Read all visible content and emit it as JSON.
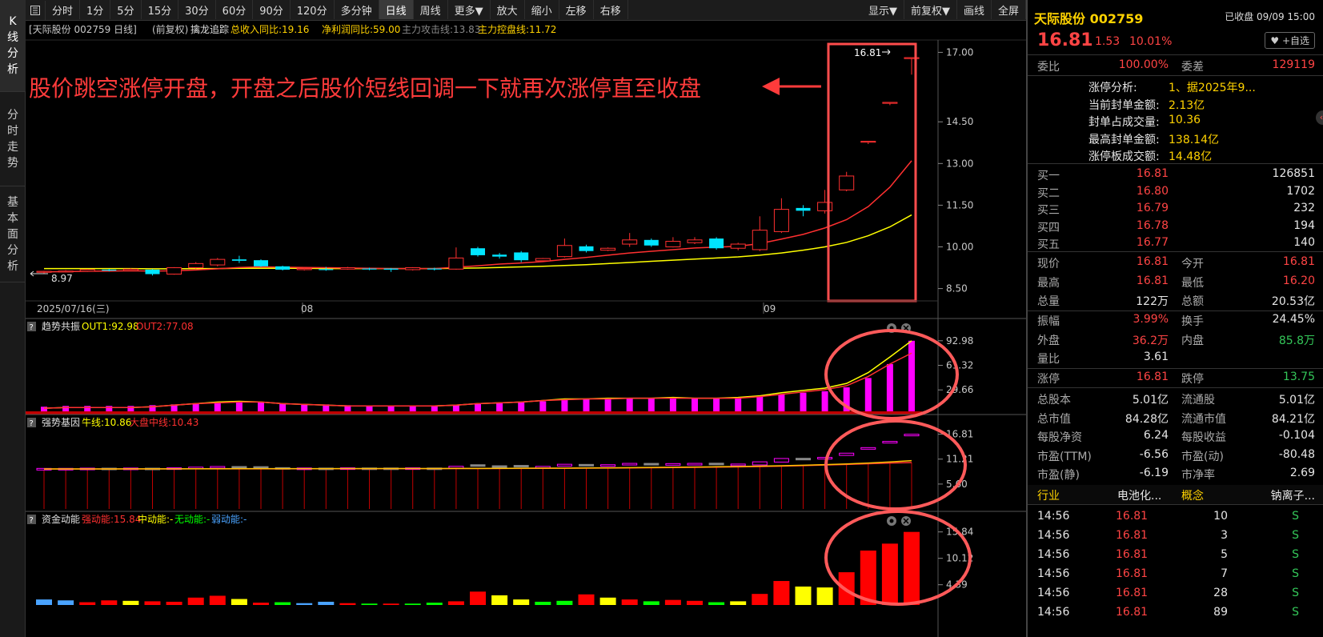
{
  "sidebar": {
    "tabs": [
      {
        "label": "K线分析",
        "active": true
      },
      {
        "label": "分时走势",
        "active": false
      },
      {
        "label": "基本面分析",
        "active": false
      }
    ]
  },
  "toolbar": {
    "left_items": [
      "分时",
      "1分",
      "5分",
      "15分",
      "30分",
      "60分",
      "90分",
      "120分",
      "多分钟",
      "日线",
      "周线",
      "更多▼",
      "放大",
      "缩小",
      "左移",
      "右移"
    ],
    "active": "日线",
    "right_items": [
      "显示▼",
      "前复权▼",
      "画线",
      "全屏"
    ]
  },
  "main_chart": {
    "header_prefix": "[天际股份 002759 日线]",
    "adjust": "(前复权)",
    "indicator_name": "擒龙追踪",
    "revenue_yoy": "总收入同比:19.16",
    "profit_yoy": "净利润同比:59.00",
    "main_attack": "主力攻击线:13.83",
    "main_control": "主力控盘线:11.72",
    "y_ticks": [
      "17.00",
      "14.50",
      "13.00",
      "11.50",
      "10.00",
      "8.50"
    ],
    "x_labels": [
      "2025/07/16(三)",
      "08",
      "09"
    ],
    "low_label": "8.97",
    "high_label": "16.81",
    "annotation": "股价跳空涨停开盘，开盘之后股价短线回调一下就再次涨停直至收盘"
  },
  "panel1": {
    "title": "趋势共振",
    "out1": "OUT1:92.98",
    "out2": "OUT2:77.08",
    "y_ticks": [
      "92.98",
      "61.32",
      "29.66"
    ]
  },
  "panel2": {
    "title": "强势基因",
    "bull": "牛线:10.86",
    "market": "大盘中线:10.43",
    "y_ticks": [
      "16.81",
      "11.21",
      "5.60"
    ]
  },
  "panel3": {
    "title": "资金动能",
    "strong": "强动能:15.84",
    "mid": "中动能:-",
    "none": "无动能:-",
    "weak": "弱动能:-",
    "y_ticks": [
      "15.84",
      "10.12",
      "4.39"
    ]
  },
  "quote": {
    "name": "天际股份 002759",
    "status": "已收盘 09/09 15:00",
    "price": "16.81",
    "change": "1.53",
    "change_pct": "10.01%",
    "watch_btn": "+自选",
    "weibi_label": "委比",
    "weibi": "100.00%",
    "weicha_label": "委差",
    "weicha": "129119",
    "limit_analysis": [
      {
        "label": "涨停分析:",
        "value": "1、据2025年9..."
      },
      {
        "label": "当前封单金额:",
        "value": "2.13亿"
      },
      {
        "label": "封单占成交量:",
        "value": "10.36"
      },
      {
        "label": "最高封单金额:",
        "value": "138.14亿"
      },
      {
        "label": "涨停板成交额:",
        "value": "14.48亿"
      }
    ],
    "bids": [
      {
        "label": "买一",
        "price": "16.81",
        "vol": "126851"
      },
      {
        "label": "买二",
        "price": "16.80",
        "vol": "1702"
      },
      {
        "label": "买三",
        "price": "16.79",
        "vol": "232"
      },
      {
        "label": "买四",
        "price": "16.78",
        "vol": "194"
      },
      {
        "label": "买五",
        "price": "16.77",
        "vol": "140"
      }
    ],
    "stats_a": [
      [
        "现价",
        "16.81",
        "red",
        "今开",
        "16.81",
        "red"
      ],
      [
        "最高",
        "16.81",
        "red",
        "最低",
        "16.20",
        "red"
      ],
      [
        "总量",
        "122万",
        "white",
        "总额",
        "20.53亿",
        "white"
      ]
    ],
    "stats_b": [
      [
        "振幅",
        "3.99%",
        "red",
        "换手",
        "24.45%",
        "white"
      ],
      [
        "外盘",
        "36.2万",
        "red",
        "内盘",
        "85.8万",
        "green"
      ],
      [
        "量比",
        "3.61",
        "white",
        "",
        "",
        ""
      ]
    ],
    "stats_c": [
      [
        "涨停",
        "16.81",
        "red",
        "跌停",
        "13.75",
        "green"
      ]
    ],
    "stats_d": [
      [
        "总股本",
        "5.01亿",
        "白",
        "流通股",
        "5.01亿",
        "white"
      ],
      [
        "总市值",
        "84.28亿",
        "white",
        "流通市值",
        "84.21亿",
        "white"
      ],
      [
        "每股净资",
        "6.24",
        "white",
        "每股收益",
        "-0.104",
        "white"
      ],
      [
        "市盈(TTM)",
        "-6.56",
        "white",
        "市盈(动)",
        "-80.48",
        "white"
      ],
      [
        "市盈(静)",
        "-6.19",
        "white",
        "市净率",
        "2.69",
        "white"
      ]
    ],
    "industry_label": "行业",
    "industry": "电池化...",
    "concept_label": "概念",
    "concept": "钠离子...",
    "ticks": [
      {
        "time": "14:56",
        "price": "16.81",
        "vol": "10",
        "side": "S"
      },
      {
        "time": "14:56",
        "price": "16.81",
        "vol": "3",
        "side": "S"
      },
      {
        "time": "14:56",
        "price": "16.81",
        "vol": "5",
        "side": "S"
      },
      {
        "time": "14:56",
        "price": "16.81",
        "vol": "7",
        "side": "S"
      },
      {
        "time": "14:56",
        "price": "16.81",
        "vol": "28",
        "side": "S"
      },
      {
        "time": "14:56",
        "price": "16.81",
        "vol": "89",
        "side": "S"
      }
    ]
  },
  "colors": {
    "up": "#ff3030",
    "down": "#00e5ff",
    "ma1": "#ff3030",
    "ma2": "#ffff00",
    "magenta": "#ff00ff",
    "annot": "#ff3b3b",
    "circle": "#ff5a5a"
  },
  "chart_data": {
    "type": "candlestick",
    "ylim": [
      8.2,
      17.3
    ],
    "candles": [
      [
        9.1,
        9.12,
        9.05,
        9.14
      ],
      [
        9.12,
        9.13,
        9.08,
        9.16
      ],
      [
        9.12,
        9.18,
        9.1,
        9.2
      ],
      [
        9.18,
        9.15,
        9.12,
        9.21
      ],
      [
        9.15,
        9.2,
        9.13,
        9.23
      ],
      [
        9.18,
        9.02,
        8.97,
        9.2
      ],
      [
        9.02,
        9.25,
        9.0,
        9.27
      ],
      [
        9.25,
        9.4,
        9.22,
        9.45
      ],
      [
        9.35,
        9.55,
        9.3,
        9.6
      ],
      [
        9.55,
        9.5,
        9.42,
        9.68
      ],
      [
        9.52,
        9.3,
        9.28,
        9.55
      ],
      [
        9.3,
        9.18,
        9.15,
        9.32
      ],
      [
        9.18,
        9.22,
        9.15,
        9.26
      ],
      [
        9.2,
        9.18,
        9.14,
        9.28
      ],
      [
        9.2,
        9.25,
        9.18,
        9.28
      ],
      [
        9.22,
        9.2,
        9.16,
        9.25
      ],
      [
        9.22,
        9.18,
        9.1,
        9.24
      ],
      [
        9.18,
        9.25,
        9.15,
        9.27
      ],
      [
        9.22,
        9.2,
        9.15,
        9.25
      ],
      [
        9.2,
        9.6,
        9.18,
        9.98
      ],
      [
        9.95,
        9.7,
        9.65,
        10.0
      ],
      [
        9.72,
        9.65,
        9.58,
        9.78
      ],
      [
        9.8,
        9.52,
        9.45,
        9.85
      ],
      [
        9.5,
        9.58,
        9.48,
        9.6
      ],
      [
        9.65,
        10.05,
        9.62,
        10.3
      ],
      [
        10.02,
        9.85,
        9.8,
        10.08
      ],
      [
        9.88,
        9.95,
        9.85,
        9.98
      ],
      [
        10.1,
        10.25,
        10.0,
        10.5
      ],
      [
        10.25,
        10.05,
        10.0,
        10.3
      ],
      [
        10.0,
        10.2,
        9.98,
        10.35
      ],
      [
        10.15,
        10.25,
        10.1,
        10.35
      ],
      [
        10.3,
        9.95,
        9.9,
        10.35
      ],
      [
        9.95,
        10.1,
        9.88,
        10.15
      ],
      [
        9.9,
        10.6,
        9.85,
        11.1
      ],
      [
        10.55,
        11.35,
        10.5,
        11.75
      ],
      [
        11.4,
        11.3,
        11.1,
        11.5
      ],
      [
        11.3,
        11.6,
        11.2,
        12.05
      ],
      [
        12.05,
        12.55,
        12.0,
        12.7
      ],
      [
        13.8,
        13.8,
        13.7,
        13.8
      ],
      [
        15.2,
        15.2,
        15.1,
        15.2
      ],
      [
        16.81,
        16.81,
        16.2,
        16.81
      ]
    ],
    "ma_fast": [
      9.1,
      9.11,
      9.12,
      9.13,
      9.14,
      9.13,
      9.14,
      9.17,
      9.21,
      9.26,
      9.28,
      9.27,
      9.26,
      9.25,
      9.24,
      9.23,
      9.22,
      9.22,
      9.22,
      9.27,
      9.32,
      9.38,
      9.42,
      9.47,
      9.55,
      9.62,
      9.7,
      9.78,
      9.84,
      9.9,
      9.96,
      9.99,
      10.02,
      10.12,
      10.28,
      10.45,
      10.68,
      10.98,
      11.45,
      12.15,
      13.1
    ],
    "ma_slow": [
      9.22,
      9.22,
      9.22,
      9.22,
      9.22,
      9.21,
      9.21,
      9.22,
      9.22,
      9.23,
      9.23,
      9.23,
      9.23,
      9.22,
      9.22,
      9.22,
      9.22,
      9.22,
      9.22,
      9.23,
      9.24,
      9.26,
      9.28,
      9.3,
      9.33,
      9.36,
      9.4,
      9.44,
      9.48,
      9.52,
      9.56,
      9.6,
      9.64,
      9.7,
      9.78,
      9.88,
      10.0,
      10.16,
      10.4,
      10.72,
      11.15
    ],
    "trend": {
      "bars": [
        8,
        9,
        9,
        9,
        9,
        10,
        11,
        12,
        13,
        14,
        14,
        12,
        11,
        11,
        10,
        9,
        9,
        9,
        9,
        10,
        12,
        13,
        14,
        15,
        17,
        18,
        18,
        19,
        19,
        19,
        19,
        19,
        19,
        21,
        24,
        26,
        28,
        33,
        45,
        63,
        92.98
      ],
      "yellow": [
        6,
        7,
        7,
        7,
        7,
        8,
        10,
        12,
        14,
        15,
        14,
        12,
        11,
        10,
        9,
        9,
        9,
        9,
        9,
        10,
        12,
        13,
        14,
        16,
        18,
        18,
        19,
        19,
        19,
        20,
        19,
        19,
        20,
        22,
        26,
        29,
        32,
        38,
        52,
        72,
        92.98
      ],
      "red": [
        6,
        7,
        7,
        7,
        7,
        8,
        10,
        12,
        13,
        14,
        14,
        12,
        11,
        10,
        9,
        9,
        9,
        9,
        9,
        10,
        12,
        13,
        14,
        16,
        17,
        18,
        18,
        19,
        19,
        19,
        19,
        19,
        19,
        21,
        24,
        27,
        30,
        35,
        47,
        63,
        77.08
      ],
      "ylim": [
        0,
        100
      ]
    },
    "gene": {
      "market": [
        9.0,
        9.0,
        9.0,
        9.01,
        9.01,
        9.01,
        9.02,
        9.02,
        9.03,
        9.03,
        9.03,
        9.03,
        9.04,
        9.04,
        9.05,
        9.05,
        9.06,
        9.06,
        9.07,
        9.08,
        9.09,
        9.1,
        9.11,
        9.13,
        9.15,
        9.17,
        9.2,
        9.23,
        9.27,
        9.31,
        9.36,
        9.41,
        9.47,
        9.55,
        9.64,
        9.75,
        9.88,
        10.02,
        10.18,
        10.32,
        10.43
      ],
      "bull": [
        9.0,
        9.0,
        9.01,
        9.01,
        9.02,
        9.02,
        9.03,
        9.04,
        9.05,
        9.06,
        9.06,
        9.06,
        9.07,
        9.07,
        9.08,
        9.08,
        9.09,
        9.09,
        9.1,
        9.11,
        9.12,
        9.13,
        9.15,
        9.17,
        9.19,
        9.22,
        9.25,
        9.29,
        9.33,
        9.38,
        9.43,
        9.49,
        9.55,
        9.63,
        9.72,
        9.83,
        9.96,
        10.12,
        10.32,
        10.58,
        10.86
      ],
      "ylim": [
        0,
        18
      ]
    },
    "energy": {
      "values": [
        1.2,
        1.0,
        0.6,
        1.0,
        0.9,
        0.8,
        0.7,
        1.6,
        2.0,
        1.3,
        0.5,
        0.6,
        0.4,
        0.7,
        0.4,
        0.3,
        0.3,
        0.3,
        0.5,
        0.8,
        2.9,
        2.1,
        1.2,
        0.7,
        0.9,
        2.3,
        1.6,
        1.2,
        0.8,
        1.1,
        0.9,
        0.6,
        0.8,
        2.4,
        5.2,
        4.0,
        3.8,
        7.1,
        11.8,
        13.3,
        15.84
      ],
      "colors": [
        "#4aa3ff",
        "#4aa3ff",
        "#ff0000",
        "#ff0000",
        "#ffff00",
        "#ff0000",
        "#ff0000",
        "#ff0000",
        "#ff0000",
        "#ffff00",
        "#ff0000",
        "#00ff00",
        "#4aa3ff",
        "#4aa3ff",
        "#ff0000",
        "#00ff00",
        "#ff0000",
        "#00ff00",
        "#00ff00",
        "#ff0000",
        "#ff0000",
        "#ffff00",
        "#ffff00",
        "#00ff00",
        "#00ff00",
        "#ff0000",
        "#ffff00",
        "#ff0000",
        "#00ff00",
        "#ff0000",
        "#ff0000",
        "#00ff00",
        "#ffff00",
        "#ff0000",
        "#ff0000",
        "#ffff00",
        "#ffff00",
        "#ff0000",
        "#ff0000",
        "#ff0000",
        "#ff0000"
      ],
      "ylim": [
        0,
        17
      ]
    }
  }
}
